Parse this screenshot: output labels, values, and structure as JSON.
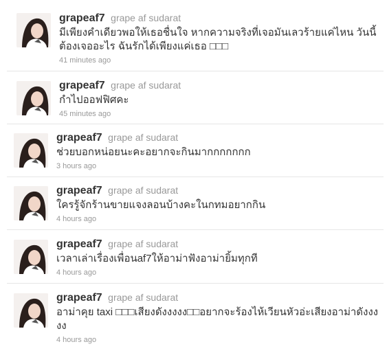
{
  "tweets": [
    {
      "screen_name": "grapeaf7",
      "full_name": "grape af sudarat",
      "text": "มีเพียงคำเดียวพอให้เธอชื่นใจ หากความจริงที่เจอมันเลวร้ายแค่ไหน วันนี้ต้องเจออะไร ฉันรักได้เพียงแค่เธอ □□□",
      "time": "41 minutes ago",
      "avatar_icon": "profile-photo"
    },
    {
      "screen_name": "grapeaf7",
      "full_name": "grape af sudarat",
      "text": "กำไปออฟฟิศคะ",
      "time": "45 minutes ago",
      "avatar_icon": "profile-photo"
    },
    {
      "screen_name": "grapeaf7",
      "full_name": "grape af sudarat",
      "text": "ช่วยบอกหน่อยนะคะอยากจะกินมากกกกกกก",
      "time": "3 hours ago",
      "avatar_icon": "profile-photo"
    },
    {
      "screen_name": "grapeaf7",
      "full_name": "grape af sudarat",
      "text": "ใครรู้จักร้านขายแจงลอนบ้างคะในกทมอยากกิน",
      "time": "4 hours ago",
      "avatar_icon": "profile-photo"
    },
    {
      "screen_name": "grapeaf7",
      "full_name": "grape af sudarat",
      "text": "เวลาเล่าเรื่องเพื่อนaf7ให้อาม่าฟังอาม่ายิ้มทุกที",
      "time": "4 hours ago",
      "avatar_icon": "profile-photo"
    },
    {
      "screen_name": "grapeaf7",
      "full_name": "grape af sudarat",
      "text": "อาม่าคุย taxi □□□เสียงดังงงงง□□อยากจะร้องไห้เวียนหัวอ่ะเสียงอาม่าดังงงงง",
      "time": "4 hours ago",
      "avatar_icon": "profile-photo"
    }
  ]
}
